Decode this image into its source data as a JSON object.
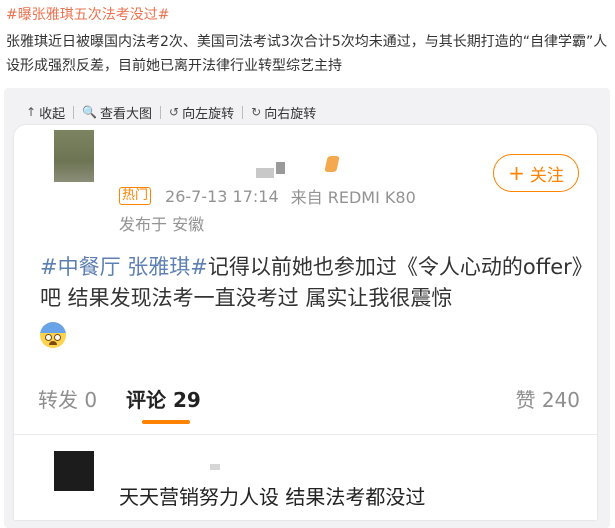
{
  "headline": "#曝张雅琪五次法考没过#",
  "summary": "张雅琪近日被曝国内法考2次、美国司法考试3次合计5次均未通过，与其长期打造的“自律学霸”人设形成强烈反差，目前她已离开法律行业转型综艺主持",
  "toolbar": {
    "collapse": {
      "icon": "↑",
      "label": "收起"
    },
    "view_large": {
      "icon": "🔍",
      "label": "查看大图"
    },
    "rotate_left": {
      "icon": "↺",
      "label": "向左旋转"
    },
    "rotate_right": {
      "icon": "↻",
      "label": "向右旋转"
    }
  },
  "post": {
    "follow_plus": "+",
    "follow_label": "关注",
    "hot_badge": "热门",
    "time": "26-7-13 17:14",
    "device": "来自 REDMI K80",
    "location": "发布于 安徽",
    "topic": "#中餐厅 张雅琪#",
    "text": "记得以前她也参加过《令人心动的offer》吧 结果发现法考一直没考过 属实让我很震惊",
    "emoji": "fearful-face-emoji"
  },
  "actions": {
    "repost": "转发 0",
    "comment": "评论 29",
    "like": "赞 240"
  },
  "comment": {
    "text": "天天营销努力人设 结果法考都没过"
  },
  "colors": {
    "accent": "#ff8200",
    "topic": "#5d7fb3",
    "headline": "#eb7350"
  }
}
